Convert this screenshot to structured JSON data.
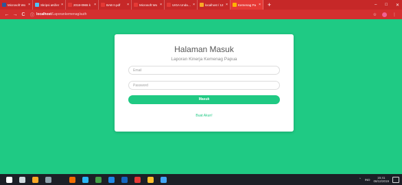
{
  "browser": {
    "tabs": [
      {
        "label": "Microsoft Wo",
        "color": "#2b579a"
      },
      {
        "label": "Skripsi aKiller",
        "color": "#4fc3f7"
      },
      {
        "label": "2018-0965 k",
        "color": "#e53935"
      },
      {
        "label": "BAB II.pdf",
        "color": "#e53935"
      },
      {
        "label": "Microsoft Wo",
        "color": "#e53935"
      },
      {
        "label": "UIGA Undangan",
        "color": "#e53935"
      },
      {
        "label": "localhost / 12",
        "color": "#f9a825"
      },
      {
        "label": "Kemenag Pa",
        "color": "#ffb300",
        "active": true
      }
    ],
    "new_tab_symbol": "+",
    "window_controls": [
      "–",
      "□",
      "✕"
    ],
    "nav": {
      "back": "←",
      "forward": "→",
      "reload": "C"
    },
    "address": {
      "host": "localhost",
      "path": "/Laporankemenag/auth",
      "info_icon": "ⓘ"
    },
    "toolbar_icons": {
      "star": "☆",
      "menu": "⋮"
    }
  },
  "login": {
    "title": "Halaman Masuk",
    "subtitle": "Laporan Kinerja Kemenag Papua",
    "email_placeholder": "Email",
    "password_placeholder": "Password",
    "submit_label": "Masuk",
    "register_link": "Buat Akun!"
  },
  "taskbar": {
    "icons": [
      {
        "name": "windows-start-icon",
        "color": "#ffffff"
      },
      {
        "name": "search-icon",
        "color": "#cfd8dc"
      },
      {
        "name": "file-explorer-icon",
        "color": "#f9a825"
      },
      {
        "name": "taskview-icon",
        "color": "#90a4ae"
      },
      {
        "name": "app-orange-icon",
        "color": "#ef6c00"
      },
      {
        "name": "edge-icon",
        "color": "#29b6f6"
      },
      {
        "name": "app-green-icon",
        "color": "#43a047"
      },
      {
        "name": "app-blue-icon",
        "color": "#1e88e5"
      },
      {
        "name": "word-icon",
        "color": "#1565c0"
      },
      {
        "name": "pdf-icon",
        "color": "#e53935"
      },
      {
        "name": "chrome-icon",
        "color": "#fbc02d"
      },
      {
        "name": "app-store-icon",
        "color": "#42a5f5"
      }
    ],
    "tray": {
      "language": "IND",
      "time": "15:41",
      "date": "08/12/2019"
    }
  },
  "colors": {
    "background": "#1fca84",
    "accent": "#1fc983",
    "chrome_bar": "#c62828"
  }
}
